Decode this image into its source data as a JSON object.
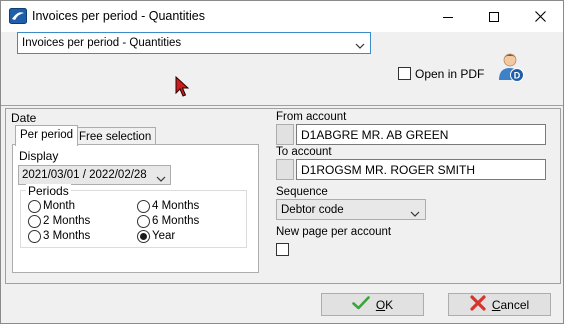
{
  "window": {
    "title": "Invoices per period - Quantities",
    "controls": {
      "minimize": "minimize-icon",
      "maximize": "maximize-icon",
      "close": "close-icon"
    }
  },
  "report": {
    "selected": "Invoices per period - Quantities",
    "open_in_pdf_label": "Open in PDF",
    "open_in_pdf_checked": false,
    "user_badge": "D"
  },
  "date": {
    "label": "Date",
    "tabs": [
      {
        "label": "Per period",
        "active": true
      },
      {
        "label": "Free selection",
        "active": false
      }
    ],
    "display_label": "Display",
    "display_value": "2021/03/01 / 2022/02/28",
    "periods_label": "Periods",
    "periods": [
      {
        "label": "Month",
        "checked": false
      },
      {
        "label": "4 Months",
        "checked": false
      },
      {
        "label": "2 Months",
        "checked": false
      },
      {
        "label": "6 Months",
        "checked": false
      },
      {
        "label": "3 Months",
        "checked": false
      },
      {
        "label": "Year",
        "checked": true
      }
    ]
  },
  "accounts": {
    "from_label": "From account",
    "from_value": "D1ABGRE MR. AB GREEN",
    "to_label": "To account",
    "to_value": "D1ROGSM MR. ROGER SMITH"
  },
  "sequence": {
    "label": "Sequence",
    "value": "Debtor code"
  },
  "new_page": {
    "label": "New page per account",
    "checked": false
  },
  "buttons": {
    "ok_mnemonic": "O",
    "ok_rest": "K",
    "cancel_mnemonic": "C",
    "cancel_rest": "ancel"
  },
  "colors": {
    "select_border": "#3c8cc8",
    "ok_check": "#3aa63a",
    "cancel_x": "#d9342b",
    "cursor": "#c81e1e"
  }
}
